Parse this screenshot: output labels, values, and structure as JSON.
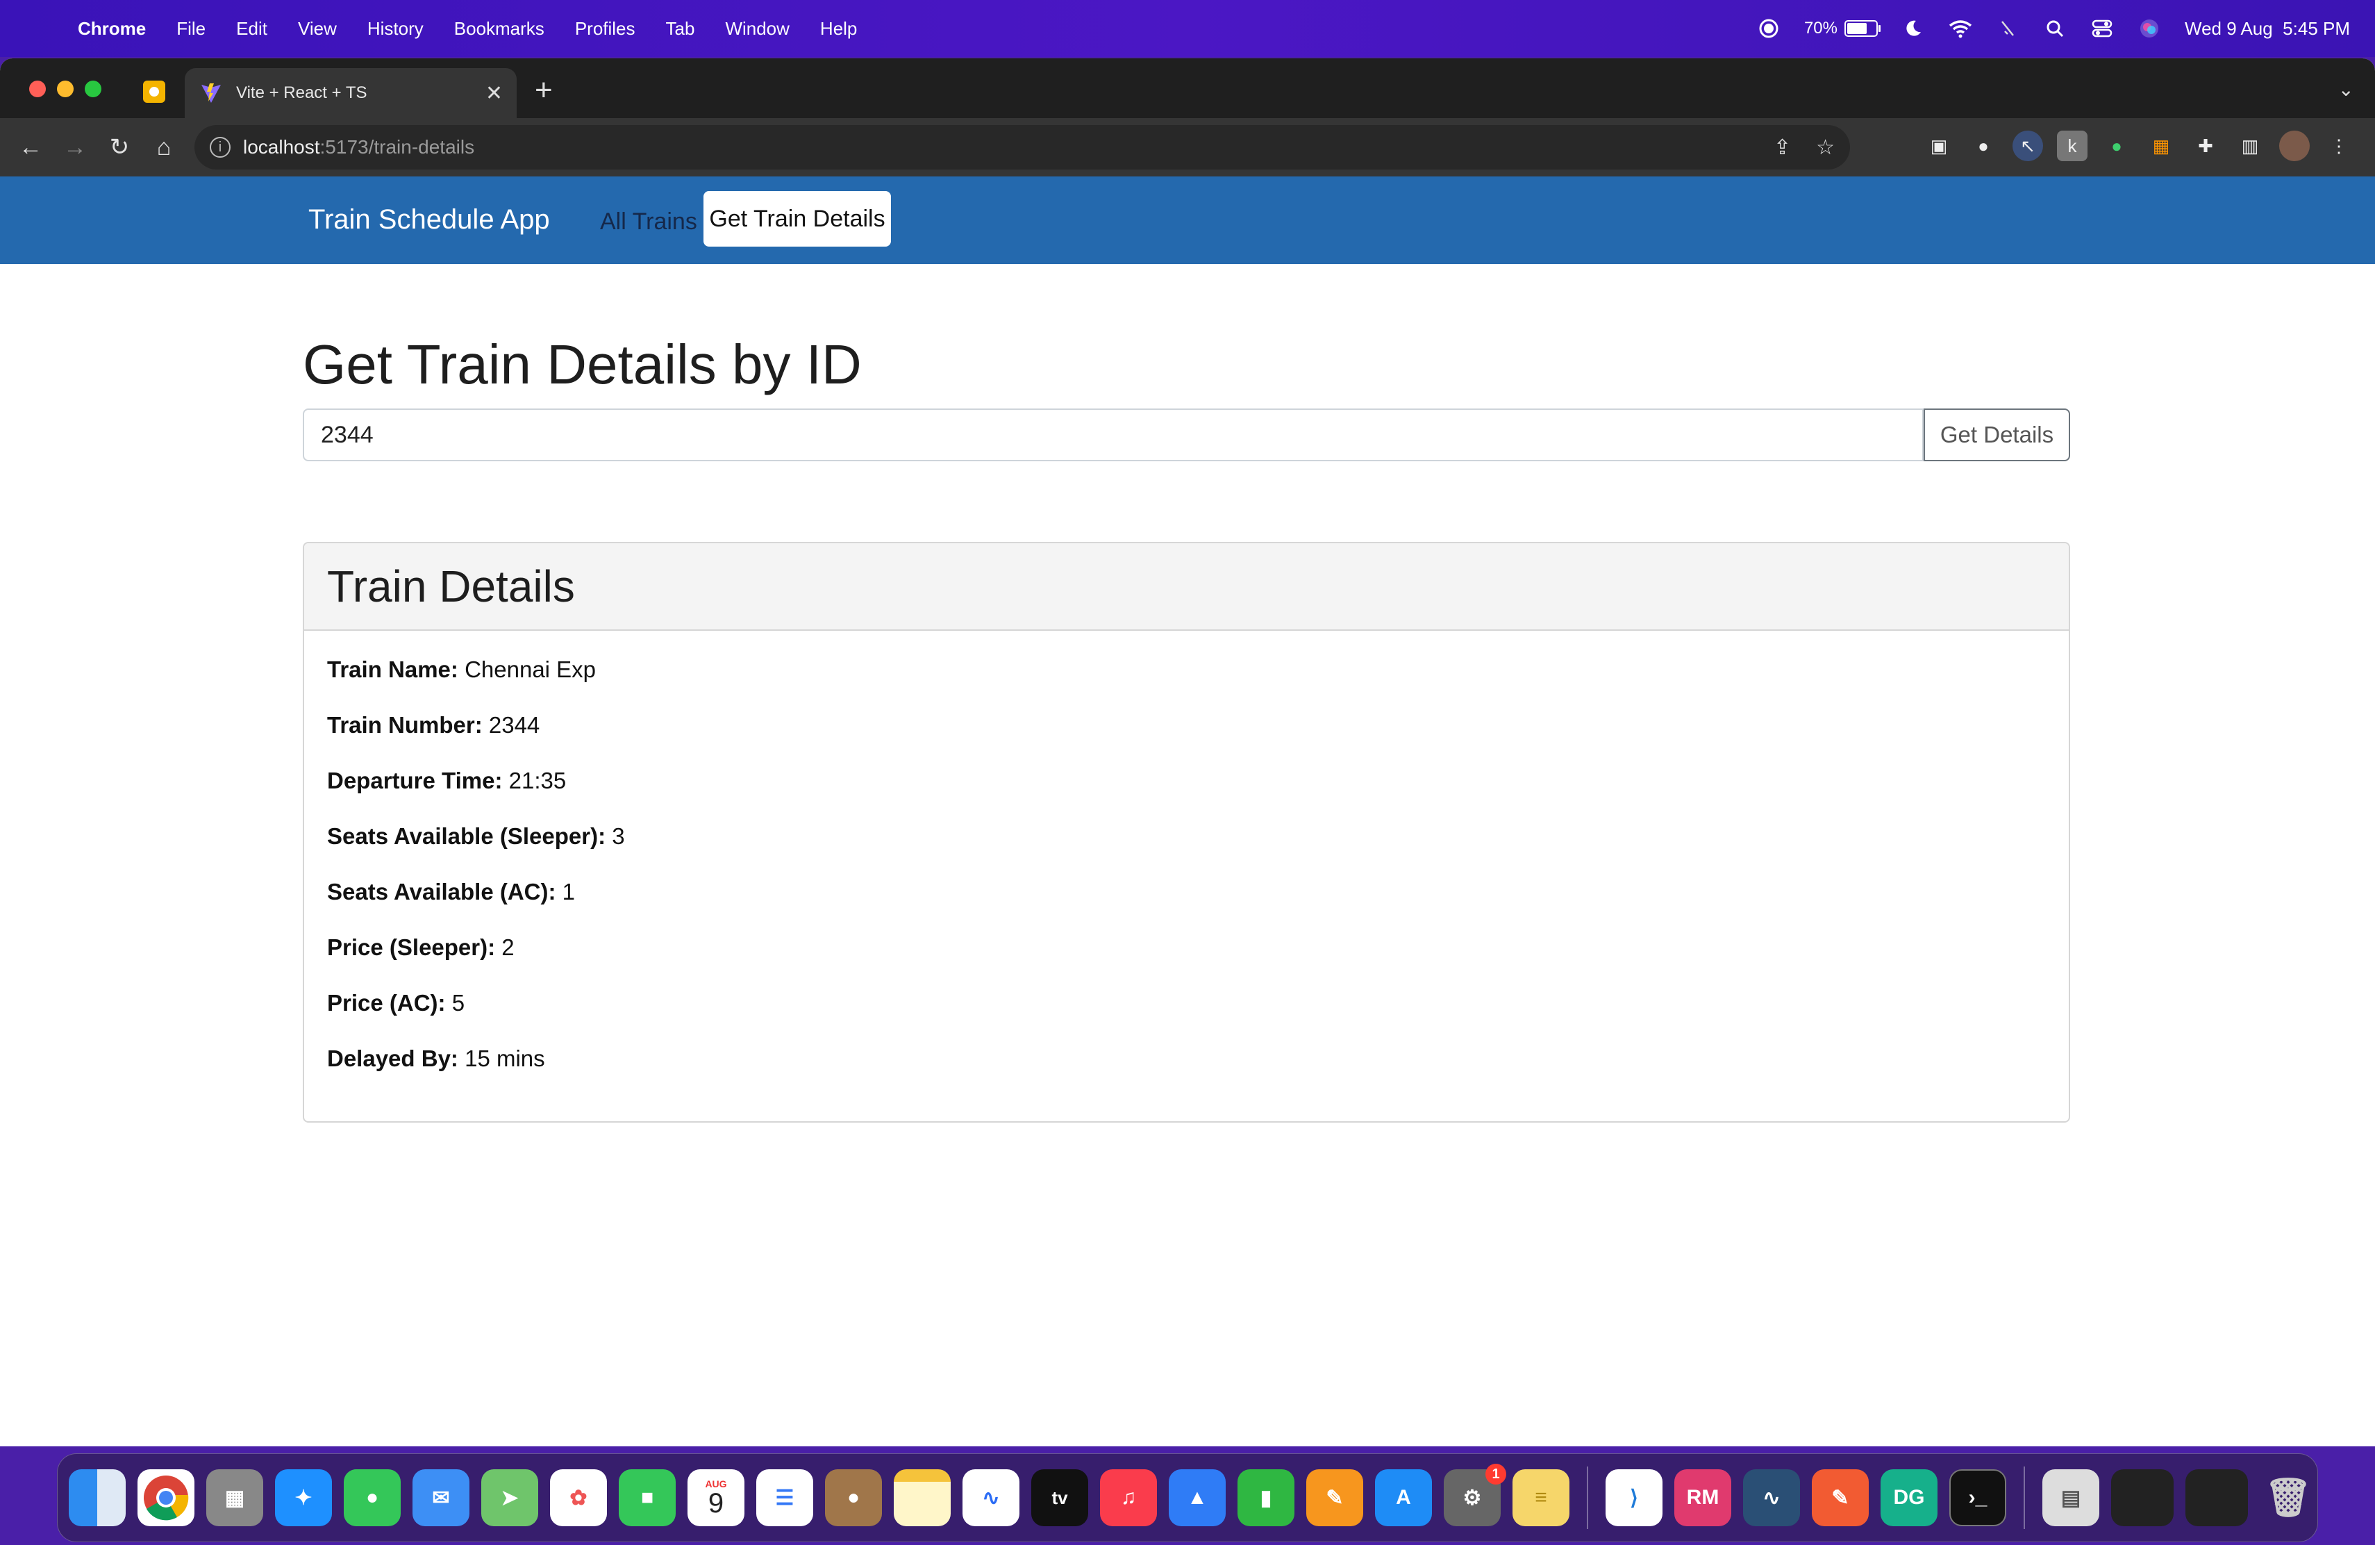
{
  "menubar": {
    "app": "Chrome",
    "menus": [
      "File",
      "Edit",
      "View",
      "History",
      "Bookmarks",
      "Profiles",
      "Tab",
      "Window",
      "Help"
    ],
    "battery_percent": "70%",
    "datetime": "Wed 9 Aug  5:45 PM"
  },
  "browser": {
    "tab_title": "Vite + React + TS",
    "url_host": "localhost",
    "url_rest": ":5173/train-details"
  },
  "app": {
    "brand": "Train Schedule App",
    "nav_all": "All Trains",
    "nav_details": "Get Train Details",
    "heading": "Get Train Details by ID",
    "input_value": "2344",
    "button_label": "Get Details",
    "card_title": "Train Details",
    "details": [
      {
        "label": "Train Name:",
        "value": "Chennai Exp"
      },
      {
        "label": "Train Number:",
        "value": "2344"
      },
      {
        "label": "Departure Time:",
        "value": "21:35"
      },
      {
        "label": "Seats Available (Sleeper):",
        "value": "3"
      },
      {
        "label": "Seats Available (AC):",
        "value": "1"
      },
      {
        "label": "Price (Sleeper):",
        "value": "2"
      },
      {
        "label": "Price (AC):",
        "value": "5"
      },
      {
        "label": "Delayed By:",
        "value": "15 mins"
      }
    ]
  },
  "dock": {
    "calendar_month": "AUG",
    "calendar_day": "9",
    "settings_badge": "1",
    "rm_label": "RM",
    "dg_label": "DG",
    "tv_label": "tv"
  }
}
